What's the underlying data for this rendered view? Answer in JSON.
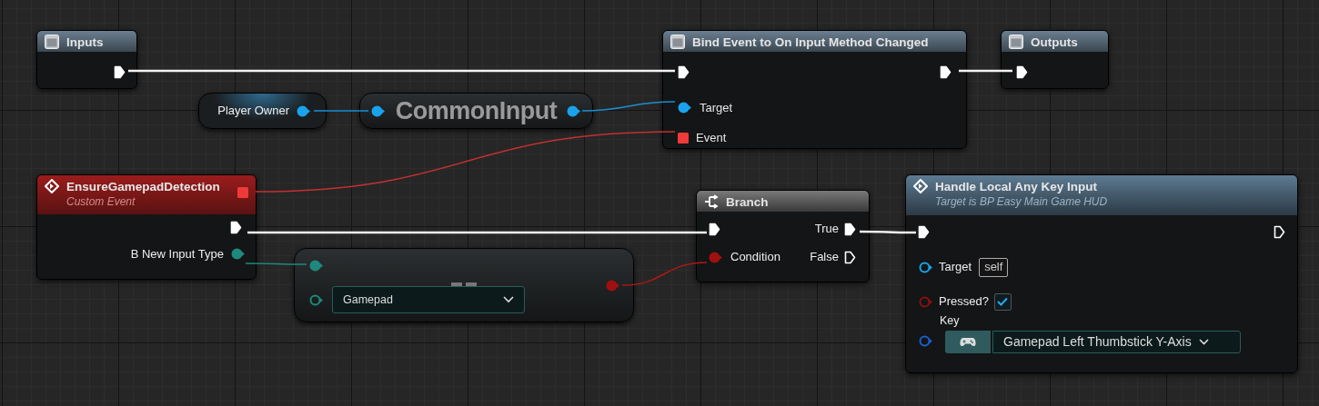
{
  "inputs_node": {
    "title": "Inputs"
  },
  "bind_node": {
    "title": "Bind Event to On Input Method Changed",
    "pins": [
      {
        "label": "Target",
        "kind": "object"
      },
      {
        "label": "Event",
        "kind": "delegate"
      }
    ]
  },
  "outputs_node": {
    "title": "Outputs"
  },
  "player_owner_node": {
    "label": "Player Owner"
  },
  "cast_node": {
    "label": "CommonInput"
  },
  "event_node": {
    "title": "EnsureGamepadDetection",
    "subtitle": "Custom Event",
    "output_pin": "B New Input Type"
  },
  "equal_node": {
    "value": "Gamepad"
  },
  "branch_node": {
    "title": "Branch",
    "condition": "Condition",
    "outputs": [
      {
        "label": "True",
        "connected": true
      },
      {
        "label": "False",
        "connected": false
      }
    ]
  },
  "handle_node": {
    "title": "Handle Local Any Key Input",
    "subtitle": "Target is BP Easy Main Game HUD",
    "exec_out_connected": false,
    "target": {
      "label": "Target",
      "value": "self"
    },
    "pressed": {
      "label": "Pressed?",
      "checked": true
    },
    "key": {
      "label": "Key",
      "value": "Gamepad Left Thumbstick Y-Axis"
    }
  }
}
